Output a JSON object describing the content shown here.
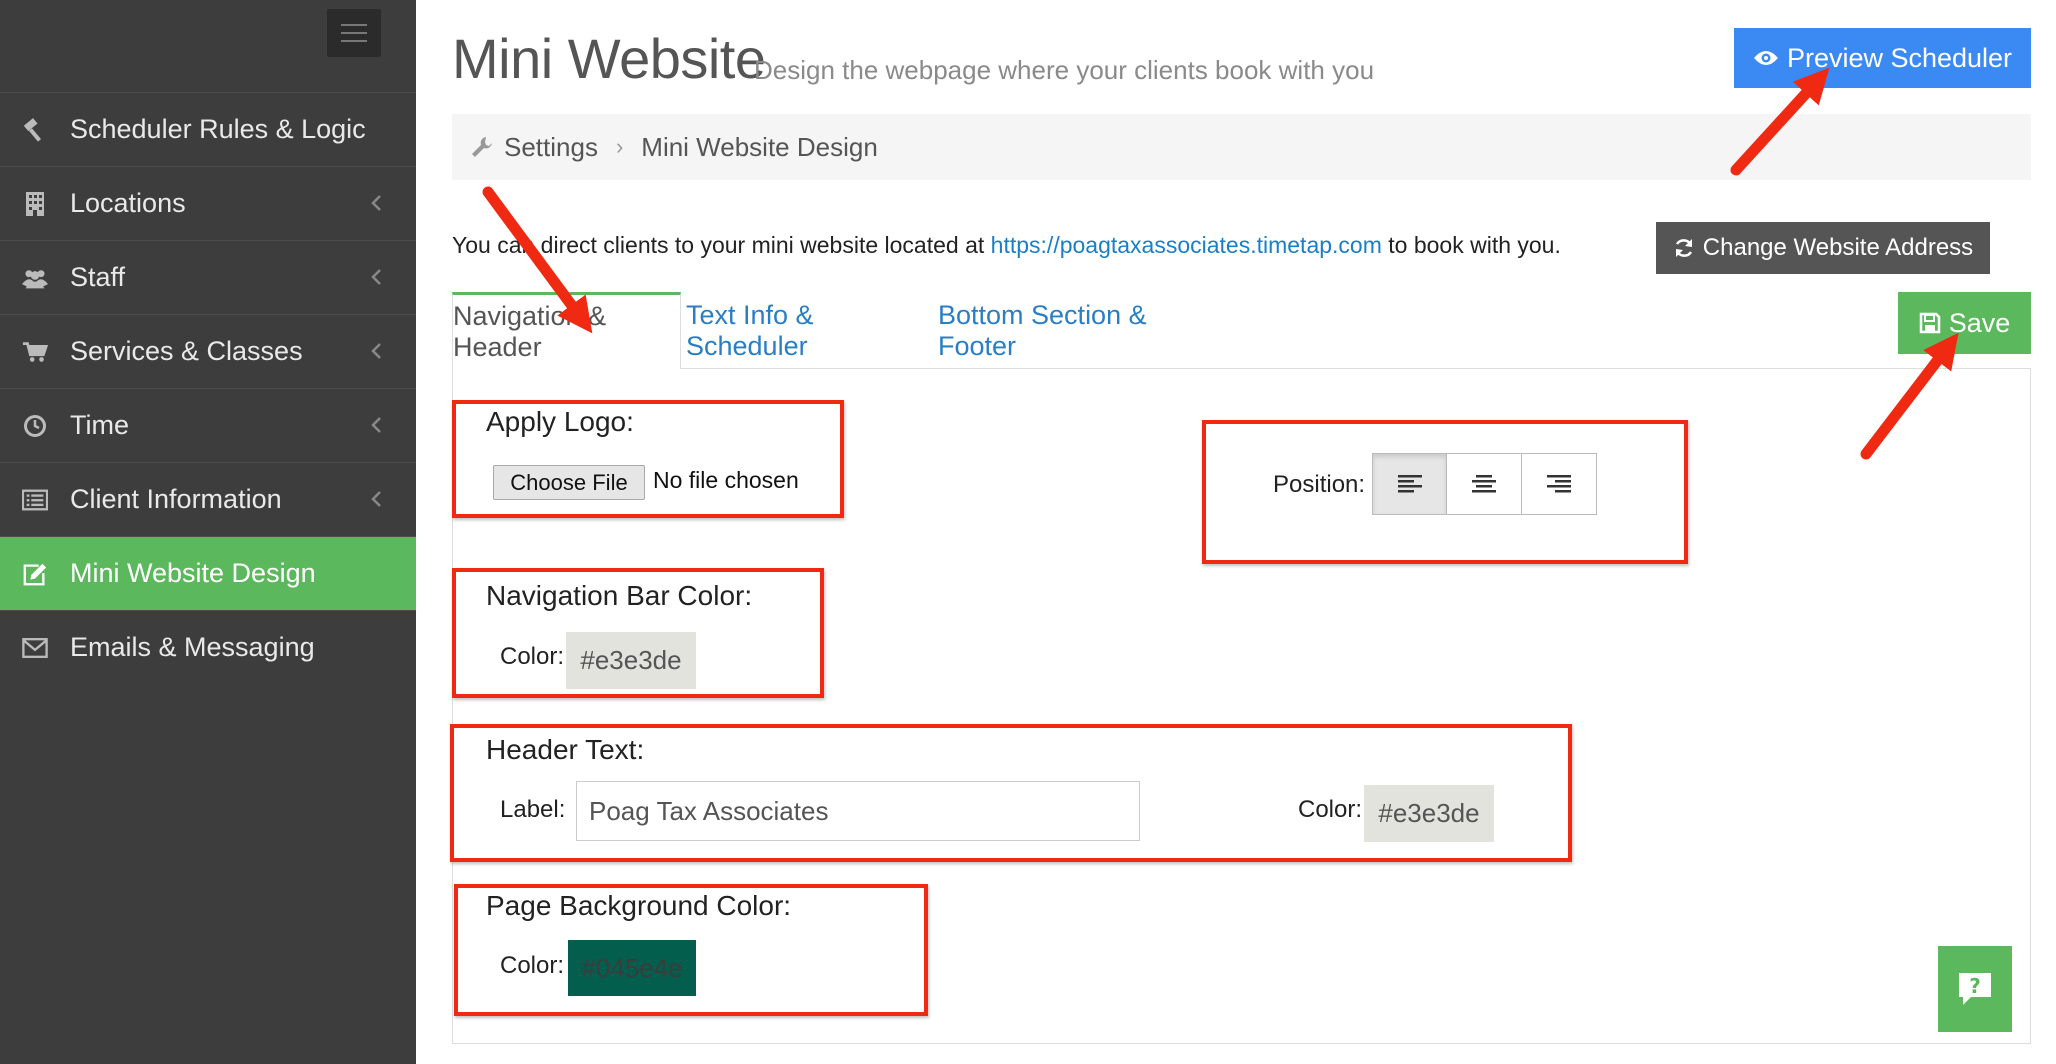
{
  "sidebar": {
    "items": [
      {
        "label": "Scheduler Rules & Logic",
        "icon": "gavel-icon",
        "has_chevron": false,
        "active": false
      },
      {
        "label": "Locations",
        "icon": "building-icon",
        "has_chevron": true,
        "active": false
      },
      {
        "label": "Staff",
        "icon": "users-icon",
        "has_chevron": true,
        "active": false
      },
      {
        "label": "Services & Classes",
        "icon": "cart-icon",
        "has_chevron": true,
        "active": false
      },
      {
        "label": "Time",
        "icon": "clock-icon",
        "has_chevron": true,
        "active": false
      },
      {
        "label": "Client Information",
        "icon": "list-icon",
        "has_chevron": true,
        "active": false
      },
      {
        "label": "Mini Website Design",
        "icon": "edit-icon",
        "has_chevron": false,
        "active": true
      },
      {
        "label": "Emails & Messaging",
        "icon": "envelope-icon",
        "has_chevron": false,
        "active": false
      }
    ]
  },
  "header": {
    "title": "Mini Website",
    "subtitle": "Design the webpage where your clients book with you",
    "preview_label": "Preview Scheduler"
  },
  "breadcrumb": {
    "items": [
      "Settings",
      "Mini Website Design"
    ]
  },
  "info": {
    "prefix": "You can direct clients to your mini website located at ",
    "url": "https://poagtaxassociates.timetap.com",
    "suffix": " to book with you.",
    "change_label": "Change Website Address"
  },
  "tabs": [
    {
      "label": "Navigation & Header",
      "active": true
    },
    {
      "label": "Text Info & Scheduler",
      "active": false
    },
    {
      "label": "Bottom Section & Footer",
      "active": false
    }
  ],
  "save_label": "Save",
  "logo": {
    "title": "Apply Logo:",
    "choose_label": "Choose File",
    "status": "No file chosen",
    "position_label": "Position:"
  },
  "nav_bar": {
    "title": "Navigation Bar Color:",
    "color_label": "Color:",
    "color_value": "#e3e3de"
  },
  "header_text": {
    "title": "Header Text:",
    "label_label": "Label:",
    "label_value": "Poag Tax Associates",
    "color_label": "Color:",
    "color_value": "#e3e3de"
  },
  "page_bg": {
    "title": "Page Background Color:",
    "color_label": "Color:",
    "color_value": "#045e4e"
  },
  "colors": {
    "sidebar_bg": "#3d3d3d",
    "active_green": "#5cb85c",
    "preview_blue": "#3b8af3",
    "link_blue": "#1a7fc4",
    "annotation_red": "#f02a12"
  }
}
